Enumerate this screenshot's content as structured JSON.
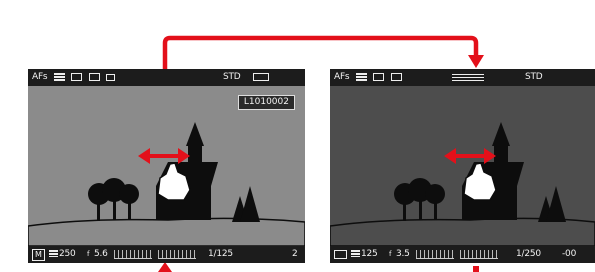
{
  "colors": {
    "arrow": "#e3101a",
    "gesture_arrow": "#e3101a",
    "screen_frame": "#1c1c1c",
    "left_view_bg": "#8b8b8b",
    "right_view_bg": "#4d4d4d",
    "silhouette": "#0d0d0d"
  },
  "left_screen": {
    "top_bar": {
      "af_mode": "AFs",
      "metering_icon": "metering-icon",
      "drive_icon": "drive-mode-icon",
      "focus_icon": "focus-field-icon",
      "format_icon": "format-icon",
      "style_label": "STD",
      "battery_icon": "battery-icon"
    },
    "file_name": "L1010002",
    "bottom_bar": {
      "mode": "M",
      "iso": "250",
      "aperture": "5.6",
      "shutter": "1/125",
      "count": "2"
    }
  },
  "right_screen": {
    "top_bar": {
      "af_mode": "AFs",
      "metering_icon": "metering-icon",
      "drive_icon": "drive-mode-icon",
      "focus_icon": "focus-field-icon",
      "wb_icon": "white-balance-icon",
      "style_label": "STD"
    },
    "bottom_bar": {
      "mode_icon": "camera-mode-icon",
      "iso": "125",
      "aperture": "3.5",
      "shutter": "1/250",
      "exposure_comp": "-00"
    }
  },
  "gesture": {
    "type": "horizontal swipe",
    "icon": "swipe-hand-icon"
  }
}
